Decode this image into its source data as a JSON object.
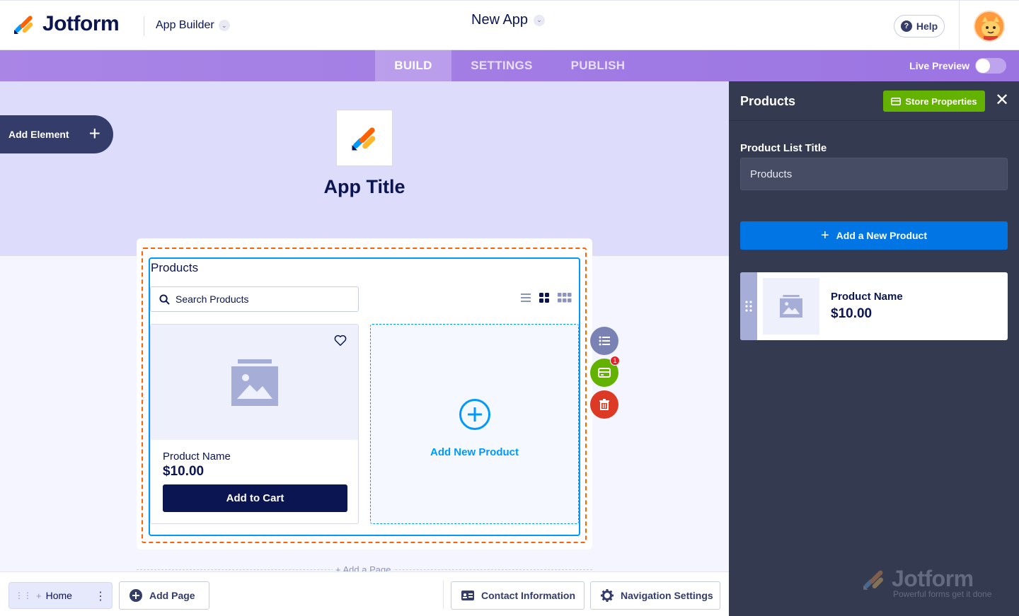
{
  "header": {
    "logo_text": "Jotform",
    "app_builder_label": "App Builder",
    "app_name": "New App",
    "help_label": "Help"
  },
  "tabs": [
    {
      "label": "BUILD",
      "active": true
    },
    {
      "label": "SETTINGS",
      "active": false
    },
    {
      "label": "PUBLISH",
      "active": false
    }
  ],
  "live_preview": {
    "label": "Live Preview",
    "enabled": false
  },
  "canvas": {
    "add_element_label": "Add Element",
    "app_title": "App Title",
    "products_title": "Products",
    "search_placeholder": "Search Products",
    "product": {
      "name": "Product Name",
      "price": "$10.00",
      "cta": "Add to Cart"
    },
    "add_new_product_label": "Add New Product",
    "notification_count": "1",
    "add_page_label": "+ Add a Page"
  },
  "bottombar": {
    "home_label": "Home",
    "add_page_label": "Add Page",
    "contact_info_label": "Contact Information",
    "navigation_settings_label": "Navigation Settings"
  },
  "panel": {
    "title": "Products",
    "store_properties_label": "Store Properties",
    "field_label": "Product List Title",
    "field_value": "Products",
    "add_product_label": "Add a New Product",
    "item": {
      "name": "Product Name",
      "price": "$10.00"
    },
    "watermark_text": "Jotform",
    "watermark_sub": "Powerful forms get it done"
  },
  "colors": {
    "brand_navy": "#0a1551",
    "tab_purple": "#9b74e2",
    "panel_bg": "#343a4f",
    "store_green": "#64b200",
    "action_blue": "#0075e3",
    "selection_orange": "#ff6100",
    "delete_red": "#dc3a24"
  }
}
